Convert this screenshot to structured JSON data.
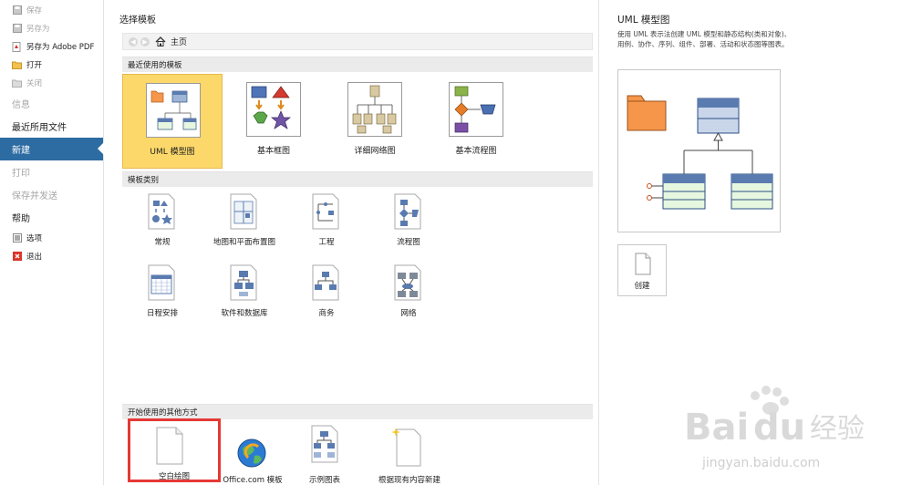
{
  "nav": {
    "save": "保存",
    "save_as": "另存为",
    "save_as_pdf": "另存为 Adobe PDF",
    "open": "打开",
    "close": "关闭",
    "info": "信息",
    "recent": "最近所用文件",
    "new": "新建",
    "print": "打印",
    "save_send": "保存并发送",
    "help": "帮助",
    "options": "选项",
    "exit": "退出"
  },
  "main": {
    "title": "选择模板",
    "home": "主页",
    "recent_header": "最近使用的模板",
    "recent": [
      {
        "label": "UML 模型图",
        "selected": true
      },
      {
        "label": "基本框图",
        "selected": false
      },
      {
        "label": "详细网络图",
        "selected": false
      },
      {
        "label": "基本流程图",
        "selected": false
      }
    ],
    "category_header": "模板类别",
    "categories": [
      "常规",
      "地图和平面布置图",
      "工程",
      "流程图",
      "日程安排",
      "软件和数据库",
      "商务",
      "网络"
    ],
    "other_header": "开始使用的其他方式",
    "other": [
      "空白绘图",
      "Office.com 模板",
      "示例图表",
      "根据现有内容新建"
    ]
  },
  "pane": {
    "title": "UML 模型图",
    "description": "使用 UML 表示法创建 UML 模型和静态结构(类和对象)、用例、协作、序列、组件、部署、活动和状态图等图表。",
    "create": "创建"
  },
  "watermark": {
    "brand": "Bai",
    "brand2": "du",
    "brand_cn": "经验",
    "url": "jingyan.baidu.com"
  },
  "colors": {
    "nav_active": "#2d6ca2",
    "tile_selected": "#fcd86a",
    "highlight_box": "#e53935"
  }
}
